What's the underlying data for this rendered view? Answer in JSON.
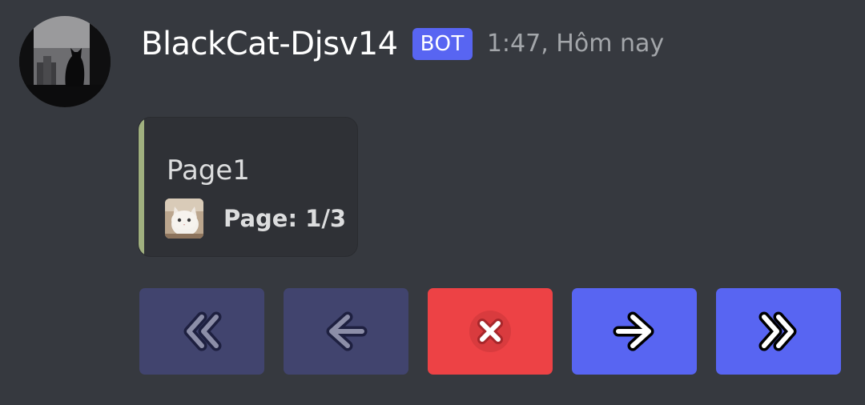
{
  "message": {
    "author": "BlackCat-Djsv14",
    "badge": "BOT",
    "timestamp": "1:47, Hôm nay",
    "avatar_icon": "black-cat-window-photo"
  },
  "embed": {
    "accent_color": "#a0b07f",
    "title": "Page1",
    "footer_icon": "white-cat-photo",
    "footer_text": "Page: 1/3"
  },
  "buttons": [
    {
      "icon": "double-chevron-left-icon",
      "style": "secondary",
      "disabled": true
    },
    {
      "icon": "arrow-left-icon",
      "style": "secondary",
      "disabled": true
    },
    {
      "icon": "close-x-icon",
      "style": "danger",
      "disabled": false
    },
    {
      "icon": "arrow-right-icon",
      "style": "primary",
      "disabled": false
    },
    {
      "icon": "double-chevron-right-icon",
      "style": "primary",
      "disabled": false
    }
  ],
  "colors": {
    "background": "#36393f",
    "embed_background": "#2f3136",
    "blurple": "#5865f2",
    "danger": "#ed4245",
    "disabled_button": "#41446e"
  }
}
